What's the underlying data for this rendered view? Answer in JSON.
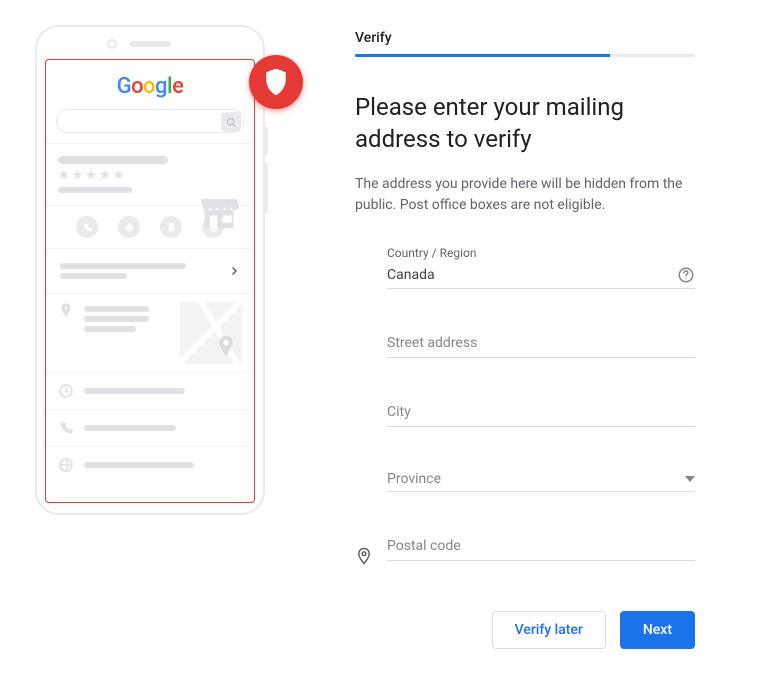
{
  "tab": {
    "label": "Verify",
    "progress": 75
  },
  "heading": "Please enter your mailing address to verify",
  "subtext": "The address you provide here will be hidden from the public. Post office boxes are not eligible.",
  "country": {
    "label": "Country / Region",
    "value": "Canada"
  },
  "street": {
    "placeholder": "Street address"
  },
  "city": {
    "placeholder": "City"
  },
  "province": {
    "placeholder": "Province"
  },
  "postal": {
    "placeholder": "Postal code"
  },
  "actions": {
    "later": "Verify later",
    "next": "Next"
  },
  "illustration": {
    "logo": "Google"
  }
}
